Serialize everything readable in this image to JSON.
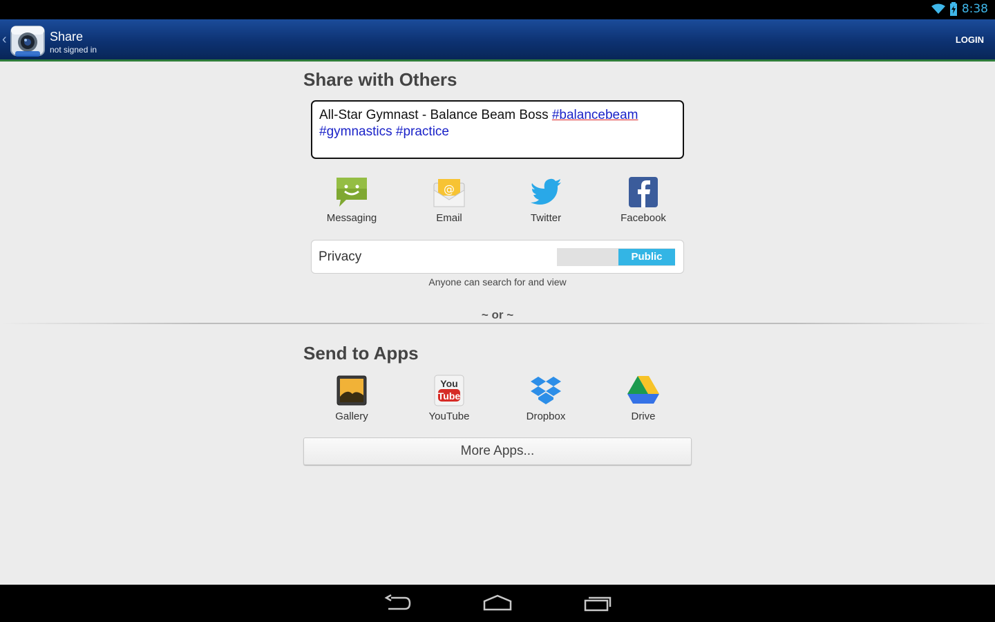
{
  "status_bar": {
    "time": "8:38",
    "icons": [
      "wifi-icon",
      "battery-icon"
    ]
  },
  "action_bar": {
    "title": "Share",
    "subtitle": "not signed in",
    "login": "LOGIN"
  },
  "share_section": {
    "heading": "Share with Others",
    "caption": {
      "plain_text": "All-Star Gymnast - Balance Beam Boss ",
      "tag1": "#balancebeam",
      "tag2": "#gymnastics",
      "tag3": "#practice"
    },
    "targets": [
      {
        "label": "Messaging",
        "icon": "messaging-icon"
      },
      {
        "label": "Email",
        "icon": "email-icon"
      },
      {
        "label": "Twitter",
        "icon": "twitter-icon"
      },
      {
        "label": "Facebook",
        "icon": "facebook-icon"
      }
    ],
    "privacy": {
      "label": "Privacy",
      "value": "Public",
      "note": "Anyone can search for and view"
    }
  },
  "or_text": "~ or ~",
  "apps_section": {
    "heading": "Send to Apps",
    "apps": [
      {
        "label": "Gallery",
        "icon": "gallery-icon"
      },
      {
        "label": "YouTube",
        "icon": "youtube-icon"
      },
      {
        "label": "Dropbox",
        "icon": "dropbox-icon"
      },
      {
        "label": "Drive",
        "icon": "drive-icon"
      }
    ],
    "more_button": "More Apps..."
  },
  "colors": {
    "accent": "#33b5e5",
    "action_bar": "#0d3272",
    "tag": "#1a22c8"
  }
}
